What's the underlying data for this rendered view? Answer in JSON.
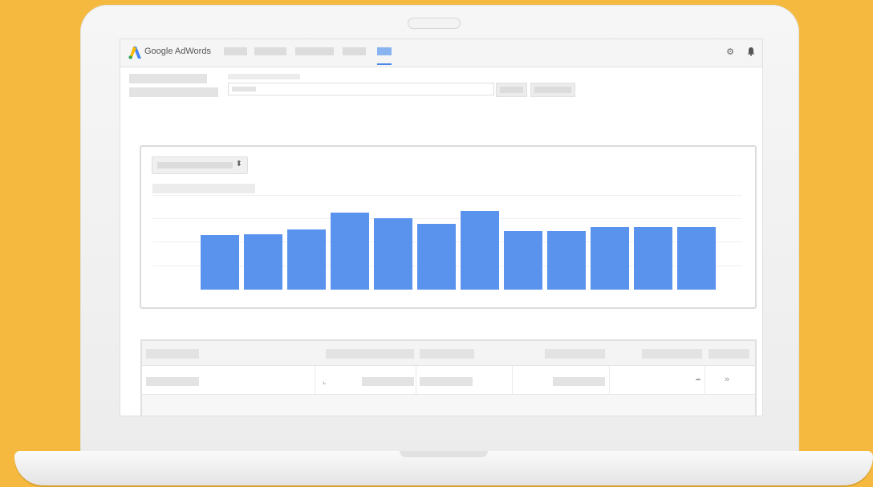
{
  "app": {
    "title": "Google AdWords",
    "brand_colors": {
      "blue": "#4285f4",
      "yellow": "#fbbc04",
      "green": "#34a853"
    }
  },
  "toolbar": {
    "settings_icon": "gear-icon",
    "notifications_icon": "bell-icon",
    "active_tab_index": 4
  },
  "table": {
    "row_dash": "–",
    "row_more": "»",
    "trend_icon": "line-chart-icon"
  },
  "chart_data": {
    "type": "bar",
    "bar_color": "#5a93ee",
    "values": [
      68,
      69,
      75,
      96,
      89,
      82,
      98,
      73,
      73,
      78,
      78,
      78
    ],
    "ylim": [
      0,
      120
    ],
    "grid": true
  }
}
